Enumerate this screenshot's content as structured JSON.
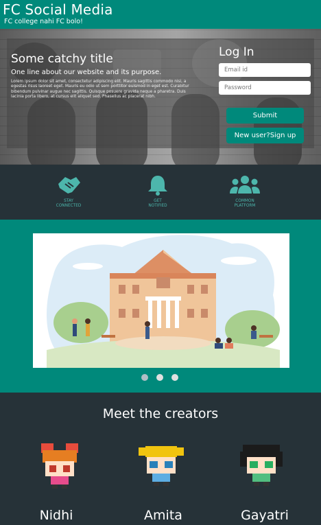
{
  "header": {
    "brand": "FC Social Media",
    "tagline": "FC college  nahi FC bolo!"
  },
  "hero": {
    "title": "Some catchy title",
    "subtitle": "One line about our website and its purpose.",
    "body": "Lorem ipsum dolor sit amet, consectetur adipiscing elit. Mauris sagittis commodo nisi, a egestas risus laoreet eget. Mauris eu odio ut sem porttitor euismod in eget est. Curabitur bibendum pulvinar augue nec sagittis. Quisque posuere gravida neque a pharetra. Duis lacinia porta libero, at cursus elit aliquet sed. Phasellus ac placerat nibh."
  },
  "login": {
    "title": "Log In",
    "email_placeholder": "Email id",
    "password_placeholder": "Password",
    "submit_label": "Submit",
    "signup_label": "New user?Sign up"
  },
  "features": [
    {
      "label_line1": "STAY",
      "label_line2": "CONNECTED",
      "icon": "handshake-icon"
    },
    {
      "label_line1": "GET",
      "label_line2": "NOTIFIED",
      "icon": "bell-icon"
    },
    {
      "label_line1": "COMMON",
      "label_line2": "PLATFORM",
      "icon": "users-icon"
    }
  ],
  "carousel": {
    "slide_count": 3,
    "active_index": 0
  },
  "creators": {
    "title": "Meet the creators",
    "people": [
      {
        "name": "Nidhi"
      },
      {
        "name": "Amita"
      },
      {
        "name": "Gayatri"
      }
    ]
  },
  "colors": {
    "teal": "#00897b",
    "dark": "#263238",
    "feature_icon": "#4db6ac"
  }
}
